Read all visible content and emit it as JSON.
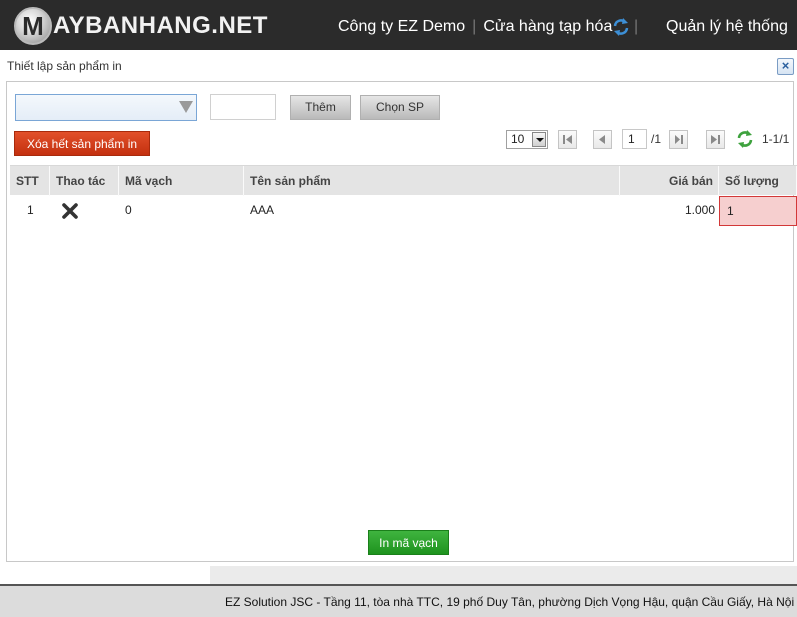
{
  "header": {
    "logo_letter": "M",
    "logo_text": "AYBANHANG.NET",
    "company": "Công ty EZ Demo",
    "store": "Cửa hàng tạp hóa",
    "admin": "Quản lý hệ thống",
    "sync_icon": "sync-icon",
    "separator": "|"
  },
  "dialog": {
    "title": "Thiết lập sản phẩm in",
    "close_label": "×"
  },
  "toolbar": {
    "product_combo_value": "",
    "quantity_value": "",
    "add_label": "Thêm",
    "choose_label": "Chọn SP",
    "clear_label": "Xóa hết sản phẩm in"
  },
  "pager": {
    "page_size": "10",
    "page": "1",
    "total_pages": "/1",
    "range": "1-1/1",
    "first_icon": "first-page-icon",
    "prev_icon": "prev-page-icon",
    "next_icon": "next-page-icon",
    "last_icon": "last-page-icon",
    "refresh_icon": "refresh-icon"
  },
  "table": {
    "columns": [
      "STT",
      "Thao tác",
      "Mã vạch",
      "Tên sản phẩm",
      "Giá bán",
      "Số lượng"
    ],
    "rows": [
      {
        "stt": "1",
        "action_icon": "delete-icon",
        "barcode": "0",
        "name": "AAA",
        "price": "1.000",
        "quantity": "1"
      }
    ]
  },
  "print_label": "In mã vạch",
  "footer": {
    "text": "EZ Solution JSC - Tầng 11, tòa nhà TTC, 19 phố Duy Tân, phường Dịch Vọng Hậu, quận Cầu Giấy, Hà Nội"
  },
  "colors": {
    "topbar": "#2b2b2b",
    "danger_button": "#c3300f",
    "print_button": "#1e931e",
    "invalid_cell": "#f6cfcf"
  }
}
